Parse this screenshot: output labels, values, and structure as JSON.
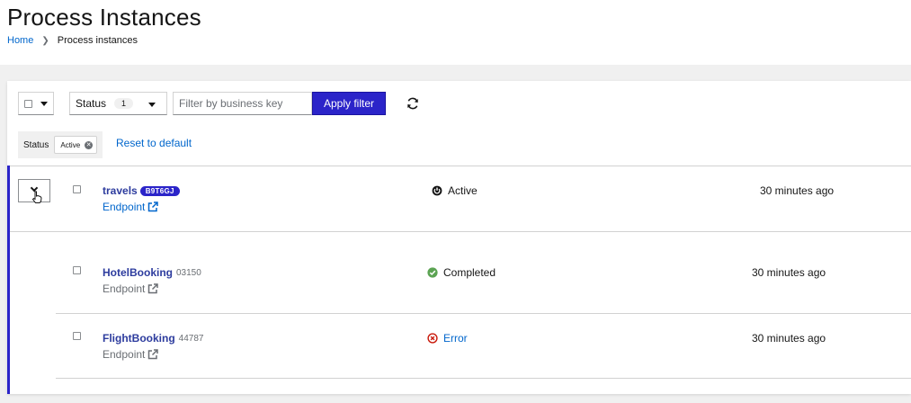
{
  "page": {
    "title": "Process Instances",
    "breadcrumb": {
      "home": "Home",
      "current": "Process instances"
    }
  },
  "toolbar": {
    "status_label": "Status",
    "status_count": "1",
    "filter_placeholder": "Filter by business key",
    "apply_label": "Apply filter"
  },
  "chips": {
    "category": "Status",
    "value": "Active",
    "reset_label": "Reset to default"
  },
  "rows": [
    {
      "name": "travels",
      "business_key": "B9T6GJ",
      "endpoint": "Endpoint",
      "state": "Active",
      "updated": "30 minutes ago"
    },
    {
      "name": "HotelBooking",
      "business_key": "03150",
      "endpoint": "Endpoint",
      "state": "Completed",
      "updated": "30 minutes ago"
    },
    {
      "name": "FlightBooking",
      "business_key": "44787",
      "endpoint": "Endpoint",
      "state": "Error",
      "updated": "30 minutes ago"
    }
  ],
  "colors": {
    "primary": "#2b24c9",
    "link": "#0066cc",
    "success": "#3e8635",
    "danger": "#c9190b"
  }
}
